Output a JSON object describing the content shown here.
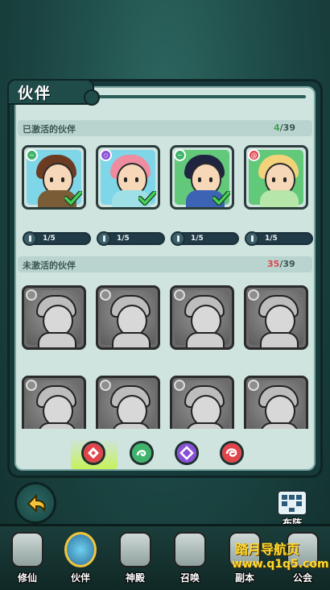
{
  "panel": {
    "title": "伙伴"
  },
  "activated": {
    "label": "已激活的伙伴",
    "count_current": "4",
    "count_total": "/39",
    "cards": [
      {
        "level": "1/5",
        "element": "wind",
        "bg": "#7fd6e8",
        "hair": "#6b3b22",
        "outfit": "#7a5d36",
        "owned": true
      },
      {
        "level": "1/5",
        "element": "arcane",
        "bg": "#7fd6e8",
        "hair": "#ef8ca0",
        "outfit": "#9fe0e6",
        "owned": true
      },
      {
        "level": "1/5",
        "element": "wind",
        "bg": "#62c97a",
        "hair": "#1f2540",
        "outfit": "#3d63b5",
        "owned": true
      },
      {
        "level": "1/5",
        "element": "fire",
        "bg": "#62c97a",
        "hair": "#f3d37a",
        "outfit": "#b7e7a8",
        "owned": false
      }
    ]
  },
  "inactive": {
    "label": "未激活的伙伴",
    "count_current": "35",
    "count_total": "/39",
    "cards": [
      {
        "name": "locked-1"
      },
      {
        "name": "locked-2"
      },
      {
        "name": "locked-3"
      },
      {
        "name": "locked-4"
      },
      {
        "name": "locked-5"
      },
      {
        "name": "locked-6"
      },
      {
        "name": "locked-7"
      },
      {
        "name": "locked-8"
      }
    ]
  },
  "filters": [
    {
      "name": "all",
      "color": "#e0454b",
      "active": true
    },
    {
      "name": "wind",
      "color": "#3fb36a",
      "active": false
    },
    {
      "name": "arcane",
      "color": "#8a4fd8",
      "active": false
    },
    {
      "name": "fire",
      "color": "#e0454b",
      "active": false
    }
  ],
  "formation": {
    "label": "布阵"
  },
  "nav": [
    {
      "label": "修仙",
      "icon": "scroll-icon"
    },
    {
      "label": "伙伴",
      "icon": "partner-portrait-icon"
    },
    {
      "label": "神殿",
      "icon": "temple-icon"
    },
    {
      "label": "召唤",
      "icon": "summon-icon"
    },
    {
      "label": "副本",
      "icon": "dungeon-icon"
    },
    {
      "label": "公会",
      "icon": "guild-icon"
    }
  ],
  "watermark": {
    "line1": "踏月导航页",
    "line2": "www.q1q5.com"
  },
  "colors": {
    "accent_green": "#3fbf5a",
    "count_red": "#e0454b",
    "count_green": "#3fa64f"
  }
}
